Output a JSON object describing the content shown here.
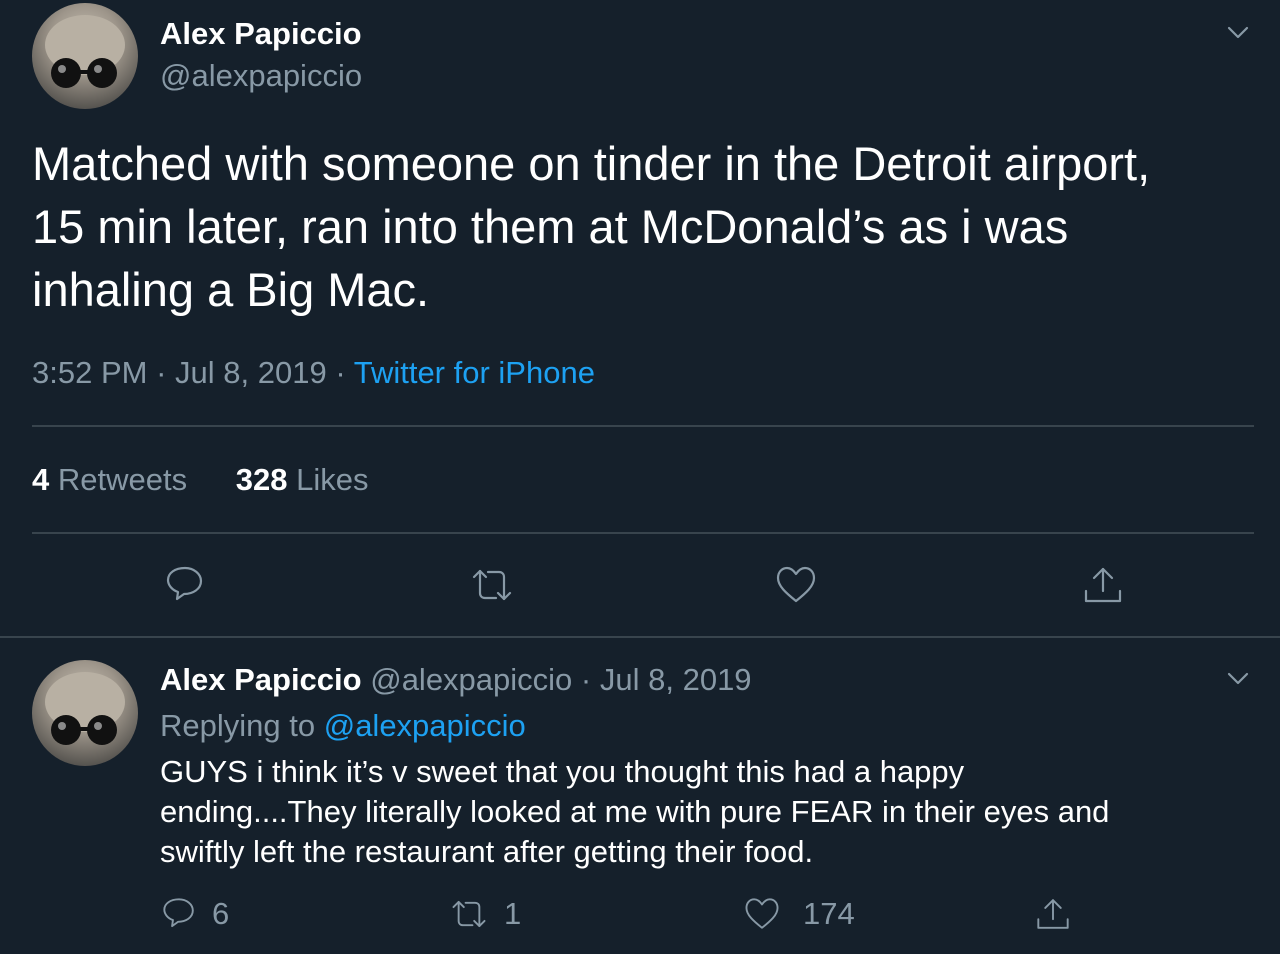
{
  "main_tweet": {
    "author_name": "Alex Papiccio",
    "handle": "@alexpapiccio",
    "text_lines": [
      "Matched with someone on tinder in the Detroit airport,",
      "15 min later, ran into them at McDonald’s as i was",
      "inhaling a Big Mac."
    ],
    "time": "3:52 PM",
    "date": "Jul 8, 2019",
    "sep": "·",
    "source": "Twitter for iPhone",
    "retweets_count": "4",
    "retweets_label": "Retweets",
    "likes_count": "328",
    "likes_label": "Likes",
    "action_icons": [
      "reply-icon",
      "retweet-icon",
      "like-icon",
      "share-icon"
    ]
  },
  "reply_tweet": {
    "author_name": "Alex Papiccio",
    "handle": "@alexpapiccio",
    "sep": "·",
    "date": "Jul 8, 2019",
    "replying_to_label": "Replying to",
    "replying_to_handle": "@alexpapiccio",
    "text_lines": [
      "GUYS i think it’s v sweet that you thought this had a happy",
      "ending....They literally looked at me with pure FEAR in their eyes and",
      "swiftly left the restaurant after getting their food."
    ],
    "reply_count": "6",
    "retweet_count": "1",
    "like_count": "174"
  },
  "colors": {
    "background": "#15202b",
    "text": "#ffffff",
    "muted": "#8899a6",
    "link": "#1da1f2",
    "divider": "#38444d"
  }
}
